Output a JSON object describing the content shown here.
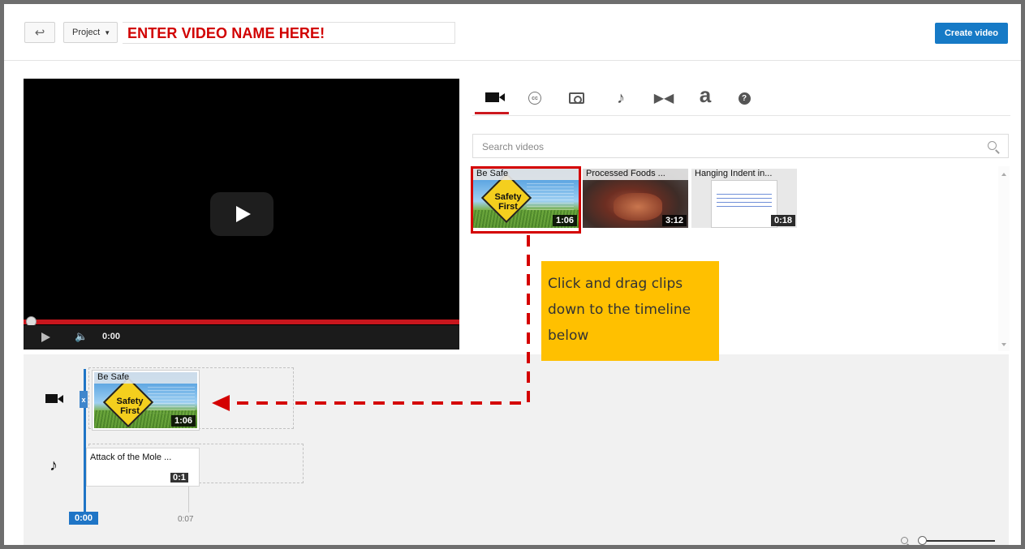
{
  "header": {
    "back_icon": "back-arrow-icon",
    "project_label": "Project",
    "video_name": "ENTER VIDEO NAME HERE!",
    "create_label": "Create video"
  },
  "player": {
    "time": "0:00",
    "progress_fraction": 0
  },
  "tabs": [
    {
      "icon": "video-camera-icon",
      "active": true
    },
    {
      "icon": "cc-icon"
    },
    {
      "icon": "photo-camera-icon"
    },
    {
      "icon": "music-note-icon"
    },
    {
      "icon": "transition-icon"
    },
    {
      "icon": "text-icon",
      "glyph": "a"
    },
    {
      "icon": "help-icon",
      "glyph": "?"
    }
  ],
  "search": {
    "placeholder": "Search videos"
  },
  "clips": [
    {
      "title": "Be Safe",
      "duration": "1:06",
      "sign_line1": "Safety",
      "sign_line2": "First"
    },
    {
      "title": "Processed Foods ...",
      "duration": "3:12"
    },
    {
      "title": "Hanging Indent in...",
      "duration": "0:18"
    }
  ],
  "callout": {
    "text": "Click and drag clips down to the timeline below"
  },
  "timeline": {
    "video_clip": {
      "title": "Be Safe",
      "duration": "1:06",
      "sign_line1": "Safety",
      "sign_line2": "First"
    },
    "audio_clip": {
      "title": "Attack of the Mole ...",
      "duration": "0:1"
    },
    "playhead": "0:00",
    "ruler_end": "0:07",
    "trim_handle_glyph": "x"
  },
  "colors": {
    "accent_red": "#cc181e",
    "create_blue": "#167ac6",
    "callout_yellow": "#ffc000",
    "annotation_red": "#d40000",
    "playhead_blue": "#1f75c6"
  }
}
